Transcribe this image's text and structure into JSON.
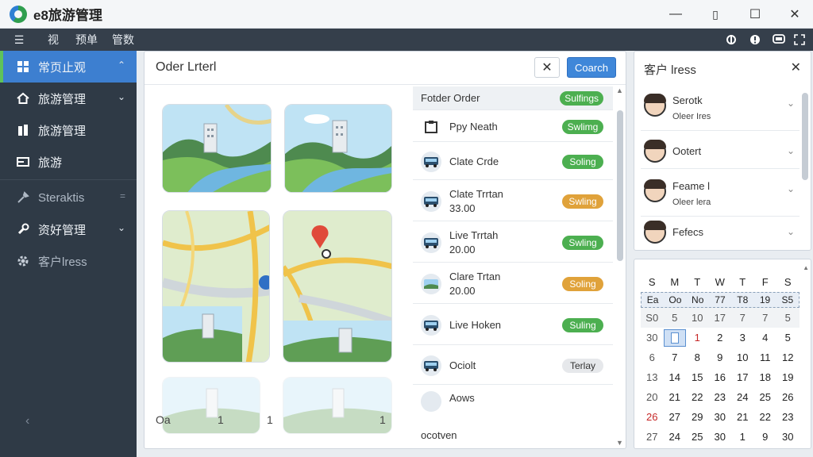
{
  "app": {
    "title": "e8旅游管理"
  },
  "window_controls": {
    "minimize": "—",
    "maximize": "☐",
    "close": "✕"
  },
  "toolbar": {
    "items": [
      "☰",
      "视",
      "预单",
      "管数"
    ]
  },
  "sidebar": {
    "items": [
      {
        "label": "常页止观",
        "icon": "dashboard-icon",
        "chevron": "⌃"
      },
      {
        "label": "旅游管理",
        "icon": "home-icon",
        "chevron": "⌄"
      },
      {
        "label": "旅游管理",
        "icon": "building-icon"
      },
      {
        "label": "旅游",
        "icon": "card-icon"
      },
      {
        "label": "Steraktis",
        "icon": "tools-icon"
      },
      {
        "label": "资好管理",
        "icon": "wrench-icon",
        "chevron": "⌄"
      },
      {
        "label": "客户lress",
        "icon": "gear-icon"
      }
    ],
    "collapse": "‹"
  },
  "main": {
    "title": "Oder Lrterl",
    "close_label": "✕",
    "primary_label": "Coarch",
    "pager": {
      "left": "Oa",
      "p1": "1",
      "p2": "1",
      "p3": "1"
    },
    "orders": [
      {
        "name": "Fotder Order",
        "badge": "Sulfings",
        "badge_type": "green",
        "head": true
      },
      {
        "name": "Ppy Neath",
        "badge": "Swlimg",
        "badge_type": "green"
      },
      {
        "name": "Clate Crde",
        "badge": "Soling",
        "badge_type": "green"
      },
      {
        "name": "Clate Trrtan",
        "sub": "33.00",
        "badge": "Swling",
        "badge_type": "orange"
      },
      {
        "name": "Live Trrtah",
        "sub": "20.00",
        "badge": "Swling",
        "badge_type": "green"
      },
      {
        "name": "Clare Trtan",
        "sub": "20.00",
        "badge": "Soling",
        "badge_type": "orange"
      },
      {
        "name": "Live Hoken",
        "badge": "Suling",
        "badge_type": "green"
      },
      {
        "name": "Ociolt",
        "badge": "Terlay",
        "badge_type": "grey"
      },
      {
        "name": "Aows"
      },
      {
        "name": "ocotven"
      }
    ]
  },
  "customers": {
    "title": "客户 lress",
    "close_label": "✕",
    "items": [
      {
        "name": "Serotk",
        "sub": "Oleer Ires"
      },
      {
        "name": "Ootert"
      },
      {
        "name": "Feame l",
        "sub": "Oleer lera"
      },
      {
        "name": "Fefecs"
      }
    ]
  },
  "calendar": {
    "weekdays": [
      "S",
      "M",
      "T",
      "W",
      "T",
      "F",
      "S"
    ],
    "highlight_row": [
      "Ea",
      "Oo",
      "No",
      "77",
      "T8",
      "19",
      "S5"
    ],
    "rows": [
      [
        "S0",
        "5",
        "10",
        "17",
        "7",
        "7",
        "5"
      ],
      [
        "30",
        "",
        "1",
        "2",
        "3",
        "4",
        "5"
      ],
      [
        "6",
        "7",
        "8",
        "9",
        "10",
        "11",
        "12"
      ],
      [
        "13",
        "14",
        "15",
        "16",
        "17",
        "18",
        "19"
      ],
      [
        "20",
        "21",
        "22",
        "23",
        "24",
        "25",
        "26"
      ],
      [
        "26",
        "27",
        "29",
        "30",
        "21",
        "22",
        "23"
      ],
      [
        "27",
        "24",
        "25",
        "30",
        "1",
        "9",
        "30"
      ]
    ]
  }
}
